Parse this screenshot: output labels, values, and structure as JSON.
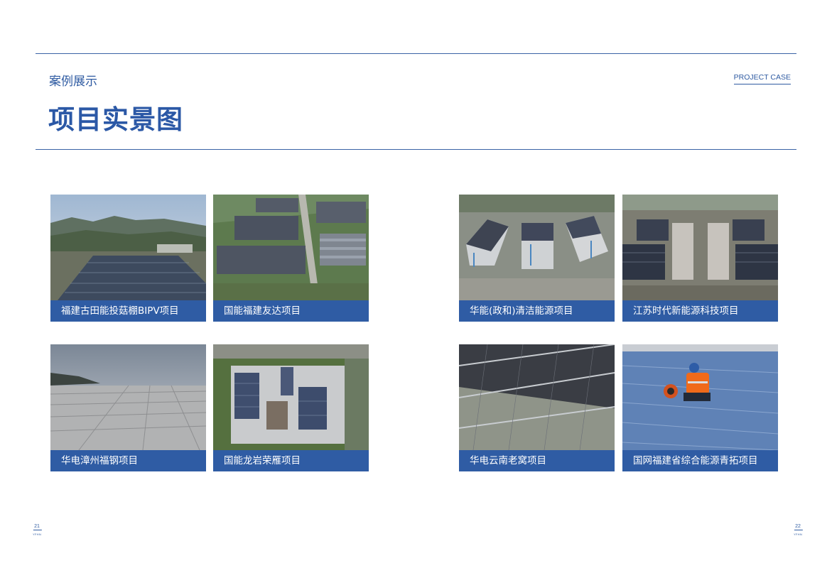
{
  "header": {
    "subtitle": "案例展示",
    "title": "项目实景图",
    "en_label": "PROJECT CASE"
  },
  "cards": [
    {
      "caption": "福建古田能投菇棚BIPV项目",
      "photo": "solar-greenhouse-valley-photo"
    },
    {
      "caption": "国能福建友达项目",
      "photo": "factory-rooftop-solar-aerial-photo"
    },
    {
      "caption": "华能(政和)清洁能源项目",
      "photo": "industrial-park-rooftop-solar-aerial-photo"
    },
    {
      "caption": "江苏时代新能源科技项目",
      "photo": "factory-complex-solar-aerial-photo"
    },
    {
      "caption": "华电漳州福钢项目",
      "photo": "metal-roof-mounting-rails-photo"
    },
    {
      "caption": "国能龙岩荣雁项目",
      "photo": "rooftop-solar-top-view-photo"
    },
    {
      "caption": "华电云南老窝项目",
      "photo": "solar-panels-underside-photo"
    },
    {
      "caption": "国网福建省综合能源青拓项目",
      "photo": "worker-on-blue-roof-photo"
    }
  ],
  "footer": {
    "page_left": "21",
    "page_right": "22",
    "brand": "YFHN"
  },
  "colors": {
    "accent": "#2f5ca4",
    "title": "#2b58a6"
  }
}
